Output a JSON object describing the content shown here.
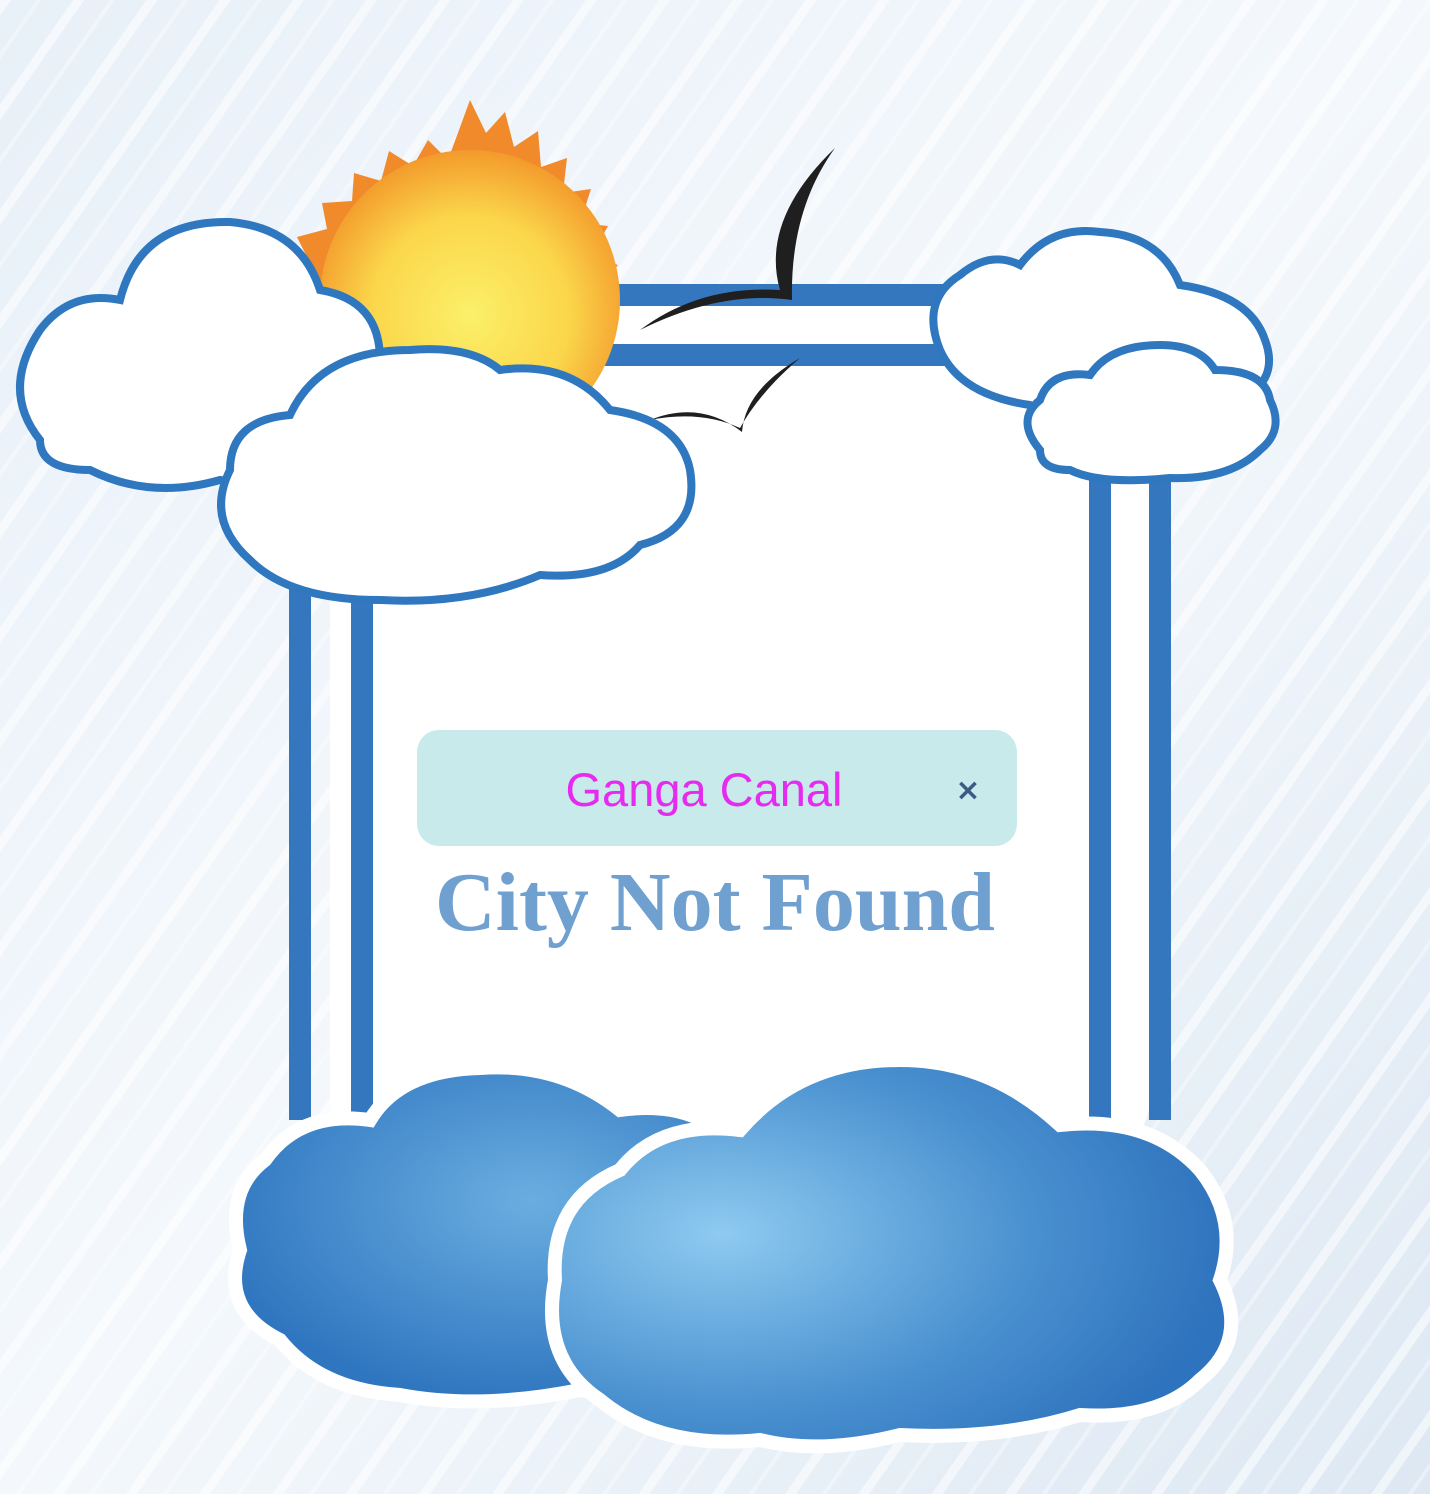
{
  "search": {
    "value": "Ganga Canal",
    "clear_label": "×"
  },
  "message": "City Not Found",
  "illustration": {
    "icons": [
      "sun-icon",
      "cloud-icon",
      "bird-icon",
      "frame-icon"
    ],
    "colors": {
      "background": "#e9f1f9",
      "frame_blue": "#3477be",
      "sun_yellow": "#fbe75a",
      "sun_orange": "#f08a2a",
      "cloud_blue": "#4f97d2",
      "input_bg": "#c8eaeb",
      "input_text": "#e52bf0",
      "message_text": "#6fa0cf"
    }
  }
}
